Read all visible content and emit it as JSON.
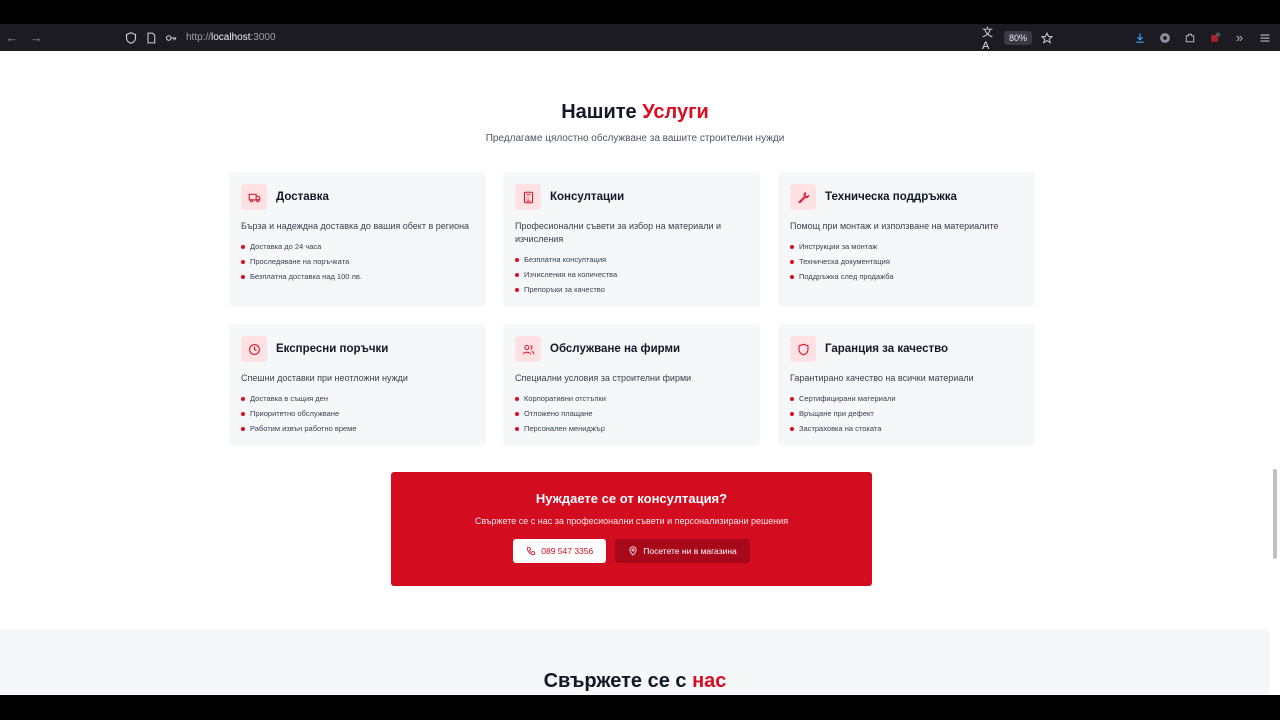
{
  "browser": {
    "url_prefix": "http://",
    "url_host": "localhost",
    "url_port": ":3000",
    "zoom": "80%"
  },
  "services": {
    "title_main": "Нашите ",
    "title_accent": "Услуги",
    "subtitle": "Предлагаме цялостно обслужване за вашите строителни нужди",
    "cards": [
      {
        "icon": "truck-icon",
        "title": "Доставка",
        "desc": "Бърза и надеждна доставка до вашия обект в региона",
        "items": [
          "Доставка до 24 часа",
          "Проследяване на поръчката",
          "Безплатна доставка над 100 лв."
        ]
      },
      {
        "icon": "calculator-icon",
        "title": "Консултации",
        "desc": "Професионални съвети за избор на материали и изчисления",
        "items": [
          "Безплатна консултация",
          "Изчисления на количества",
          "Препоръки за качество"
        ]
      },
      {
        "icon": "wrench-icon",
        "title": "Техническа поддръжка",
        "desc": "Помощ при монтаж и използване на материалите",
        "items": [
          "Инструкции за монтаж",
          "Техническа документация",
          "Поддръжка след продажба"
        ]
      },
      {
        "icon": "clock-icon",
        "title": "Експресни поръчки",
        "desc": "Спешни доставки при неотложни нужди",
        "items": [
          "Доставка в същия ден",
          "Приоритетно обслужване",
          "Работим извън работно време"
        ]
      },
      {
        "icon": "users-icon",
        "title": "Обслужване на фирми",
        "desc": "Специални условия за строителни фирми",
        "items": [
          "Корпоративни отстъпки",
          "Отложено плащане",
          "Персонален мениджър"
        ]
      },
      {
        "icon": "shield-icon",
        "title": "Гаранция за качество",
        "desc": "Гарантирано качество на всички материали",
        "items": [
          "Сертифицирани материали",
          "Връщане при дефект",
          "Застраховка на стоката"
        ]
      }
    ]
  },
  "cta": {
    "title": "Нуждаете се от консултация?",
    "subtitle": "Свържете се с нас за професионални съвети и персонализирани решения",
    "phone_label": "089 547 3356",
    "visit_label": "Посетете ни в магазина"
  },
  "contact": {
    "title_main": "Свържете се с ",
    "title_accent": "нас"
  },
  "colors": {
    "accent": "#dc0c20",
    "card_bg": "#f6f7f9",
    "icon_bg": "#fde1e3"
  }
}
